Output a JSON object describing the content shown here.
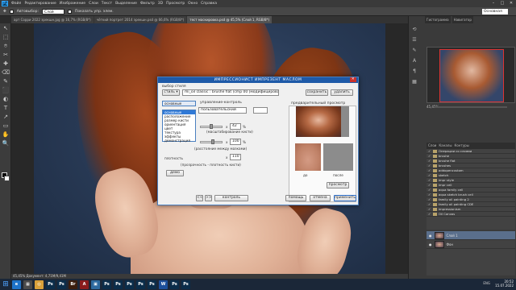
{
  "menubar": {
    "logo": "Ps",
    "items": [
      "Файл",
      "Редактирование",
      "Изображение",
      "Слои",
      "Текст",
      "Выделение",
      "Фильтр",
      "3D",
      "Просмотр",
      "Окно",
      "Справка"
    ]
  },
  "optionsbar": {
    "autoselect": "Автовыбор:",
    "group": "Слой",
    "transform": "Показать упр. элем.",
    "workspace": "Основная среда"
  },
  "tabs": [
    {
      "label": "арт Сорри 2022 эрекшн.jpg @ 16,7% (RGB/8*)",
      "active": false
    },
    {
      "label": "чёткий портрет 2014 эрекшн.psd @ 66,6% (RGB/8*)",
      "active": false
    },
    {
      "label": "тест маскировка.psd @ 45,5% (Слой 1, RGB/8*)",
      "active": true
    }
  ],
  "toolbox": [
    "↖",
    "⬚",
    "⌾",
    "✂",
    "✚",
    "⌫",
    "✎",
    "⬛",
    "◐",
    "T",
    "↗",
    "▭",
    "✋",
    "🔍"
  ],
  "dialog": {
    "title": "ИМПРЕССИОНИСТ ИМПРЕЗЕНТ МАСЛОМ",
    "style_label": "выбор стиля",
    "style_button": "стиль",
    "style_value": "mi_oil classic : brushe flat (cmp 00 [модифицированный]",
    "save": "сохранить",
    "delete": "удалить",
    "category_selected": "основные",
    "list_items": [
      "основные",
      "расположение",
      "размер кисти",
      "ориентация",
      "цвет",
      "текстура",
      "эффекты",
      "демонстрация"
    ],
    "control_label": "управление-контроль",
    "brush_preset": "пользовательский",
    "size_value": "42",
    "size_unit": "%",
    "size_caption": "(масштабирование кисти)",
    "spacing_value": "100",
    "spacing_unit": "%",
    "spacing_caption": "(расстояние между мазками)",
    "density_label": "плотность",
    "density_value": "110",
    "density_caption": "(прозрачность - плотность кисти)",
    "demo_button": "демо",
    "preview_label": "предварительный просмотр",
    "before_label": "до",
    "after_label": "после",
    "preview_button": "просмотр",
    "nav_prev": "<<",
    "nav_next": ">>",
    "control_button": "контроль",
    "help": "помощь",
    "cancel": "отмена",
    "apply": "применить"
  },
  "right_panel": {
    "tabs": [
      "Гистограмма",
      "Навигатор"
    ],
    "zoom": "45,45%",
    "layer_tabs": [
      "Слои",
      "Каналы",
      "Контуры"
    ],
    "groups": [
      "Операции со слоями",
      "brushe",
      "brushe flat",
      "brushes",
      "addopencustom",
      "sketch",
      "impr style",
      "impr cell",
      "aqua family cell",
      "aqua sketch brush cell",
      "family oil painting 2",
      "family oil painting CDE",
      "impressionism",
      "Oil Canvas"
    ],
    "layers": [
      {
        "name": "Слой 1",
        "selected": true
      },
      {
        "name": "Фон",
        "selected": false
      }
    ]
  },
  "statusbar": "45,45%    Документ: 4,71M/9,41M",
  "taskbar": {
    "apps": [
      {
        "label": "e",
        "color": "#1e73c9"
      },
      {
        "label": "▦",
        "color": "#4a4a4a"
      },
      {
        "label": "◎",
        "color": "#d9a13a"
      },
      {
        "label": "Ps",
        "color": "#0b2d4a"
      },
      {
        "label": "Ps",
        "color": "#0b2d4a"
      },
      {
        "label": "Br",
        "color": "#3b1e0e"
      },
      {
        "label": "A",
        "color": "#8a1c1c"
      },
      {
        "label": "▣",
        "color": "#2d6a9f"
      },
      {
        "label": "Ps",
        "color": "#0b2d4a"
      },
      {
        "label": "Ps",
        "color": "#0b2d4a"
      },
      {
        "label": "Ps",
        "color": "#0b2d4a"
      },
      {
        "label": "Ps",
        "color": "#0b2d4a"
      },
      {
        "label": "Ps",
        "color": "#0b2d4a"
      },
      {
        "label": "W",
        "color": "#1d4f9a"
      },
      {
        "label": "Ps",
        "color": "#0b2d4a"
      },
      {
        "label": "Ps",
        "color": "#0b2d4a"
      }
    ],
    "lang": "ENG",
    "time": "20:52",
    "date": "15.07.2022"
  }
}
